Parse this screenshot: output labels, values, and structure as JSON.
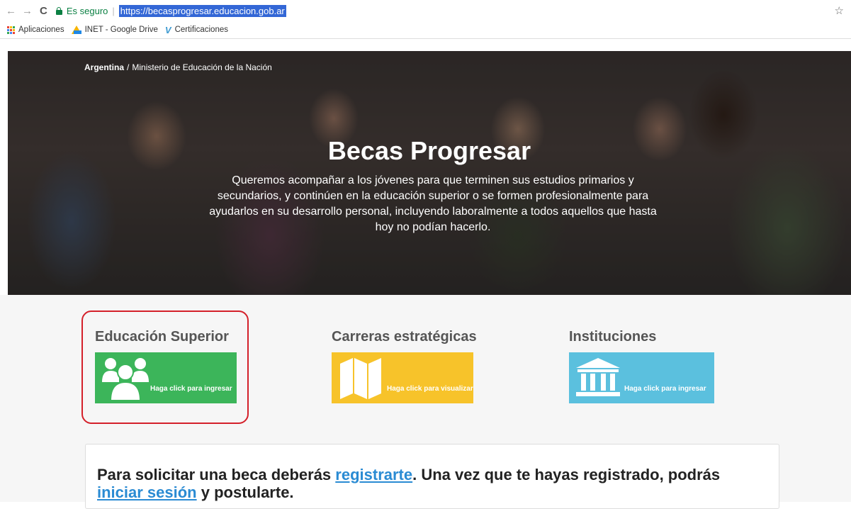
{
  "browser": {
    "secure_label": "Es seguro",
    "url": "https://becasprogresar.educacion.gob.ar",
    "bookmarks": [
      {
        "label": "Aplicaciones",
        "icon": "apps-icon"
      },
      {
        "label": "INET - Google Drive",
        "icon": "google-drive-icon"
      },
      {
        "label": "Certificaciones",
        "icon": "certificaciones-icon"
      }
    ]
  },
  "breadcrumb": {
    "first": "Argentina",
    "separator": "/",
    "second": "Ministerio de Educación de la Nación"
  },
  "hero": {
    "title": "Becas Progresar",
    "description": "Queremos acompañar a los jóvenes para que terminen sus estudios primarios y secundarios, y continúen en la educación superior o se formen profesionalmente para ayudarlos en su desarrollo personal, incluyendo laboralmente a todos aquellos que hasta hoy no podían hacerlo."
  },
  "cards": [
    {
      "title": "Educación Superior",
      "button_label": "Haga click para ingresar",
      "icon": "users-group-icon",
      "color": "#3cb55a"
    },
    {
      "title": "Carreras estratégicas",
      "button_label": "Haga click para visualizar",
      "icon": "map-icon",
      "color": "#f7c32a"
    },
    {
      "title": "Instituciones",
      "button_label": "Haga click para ingresar",
      "icon": "institution-building-icon",
      "color": "#5bc0de"
    }
  ],
  "info": {
    "text_before": "Para solicitar una beca deberás ",
    "register_link": "registrarte",
    "text_middle": ". Una vez que te hayas registrado, podrás ",
    "login_link": "iniciar sesión",
    "text_after": " y postularte."
  }
}
